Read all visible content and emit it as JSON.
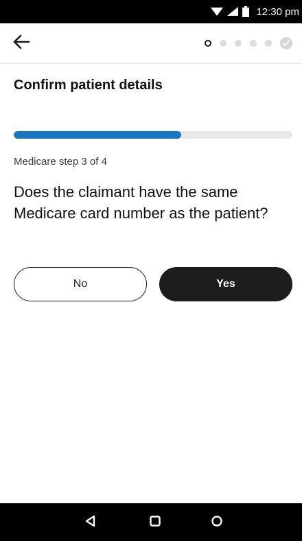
{
  "status_bar": {
    "time": "12:30 pm",
    "icons": [
      "wifi-icon",
      "signal-icon",
      "battery-icon"
    ]
  },
  "app_bar": {
    "back_icon": "arrow-left-icon",
    "steps": [
      {
        "state": "current"
      },
      {
        "state": "upcoming"
      },
      {
        "state": "upcoming"
      },
      {
        "state": "upcoming"
      },
      {
        "state": "upcoming"
      },
      {
        "state": "done",
        "icon": "check-icon"
      }
    ]
  },
  "main": {
    "title": "Confirm patient details",
    "progress_fraction": 0.6,
    "step_label": "Medicare step 3 of 4",
    "question": "Does the claimant have the same Medicare card number as the patient?",
    "answers": {
      "no_label": "No",
      "yes_label": "Yes"
    }
  },
  "nav_bar": {
    "icons": [
      "back-triangle-icon",
      "home-square-icon",
      "recents-circle-icon"
    ]
  },
  "colors": {
    "accent": "#1677c0",
    "primary_button": "#1d1d1d",
    "track": "#e8e8e8"
  }
}
